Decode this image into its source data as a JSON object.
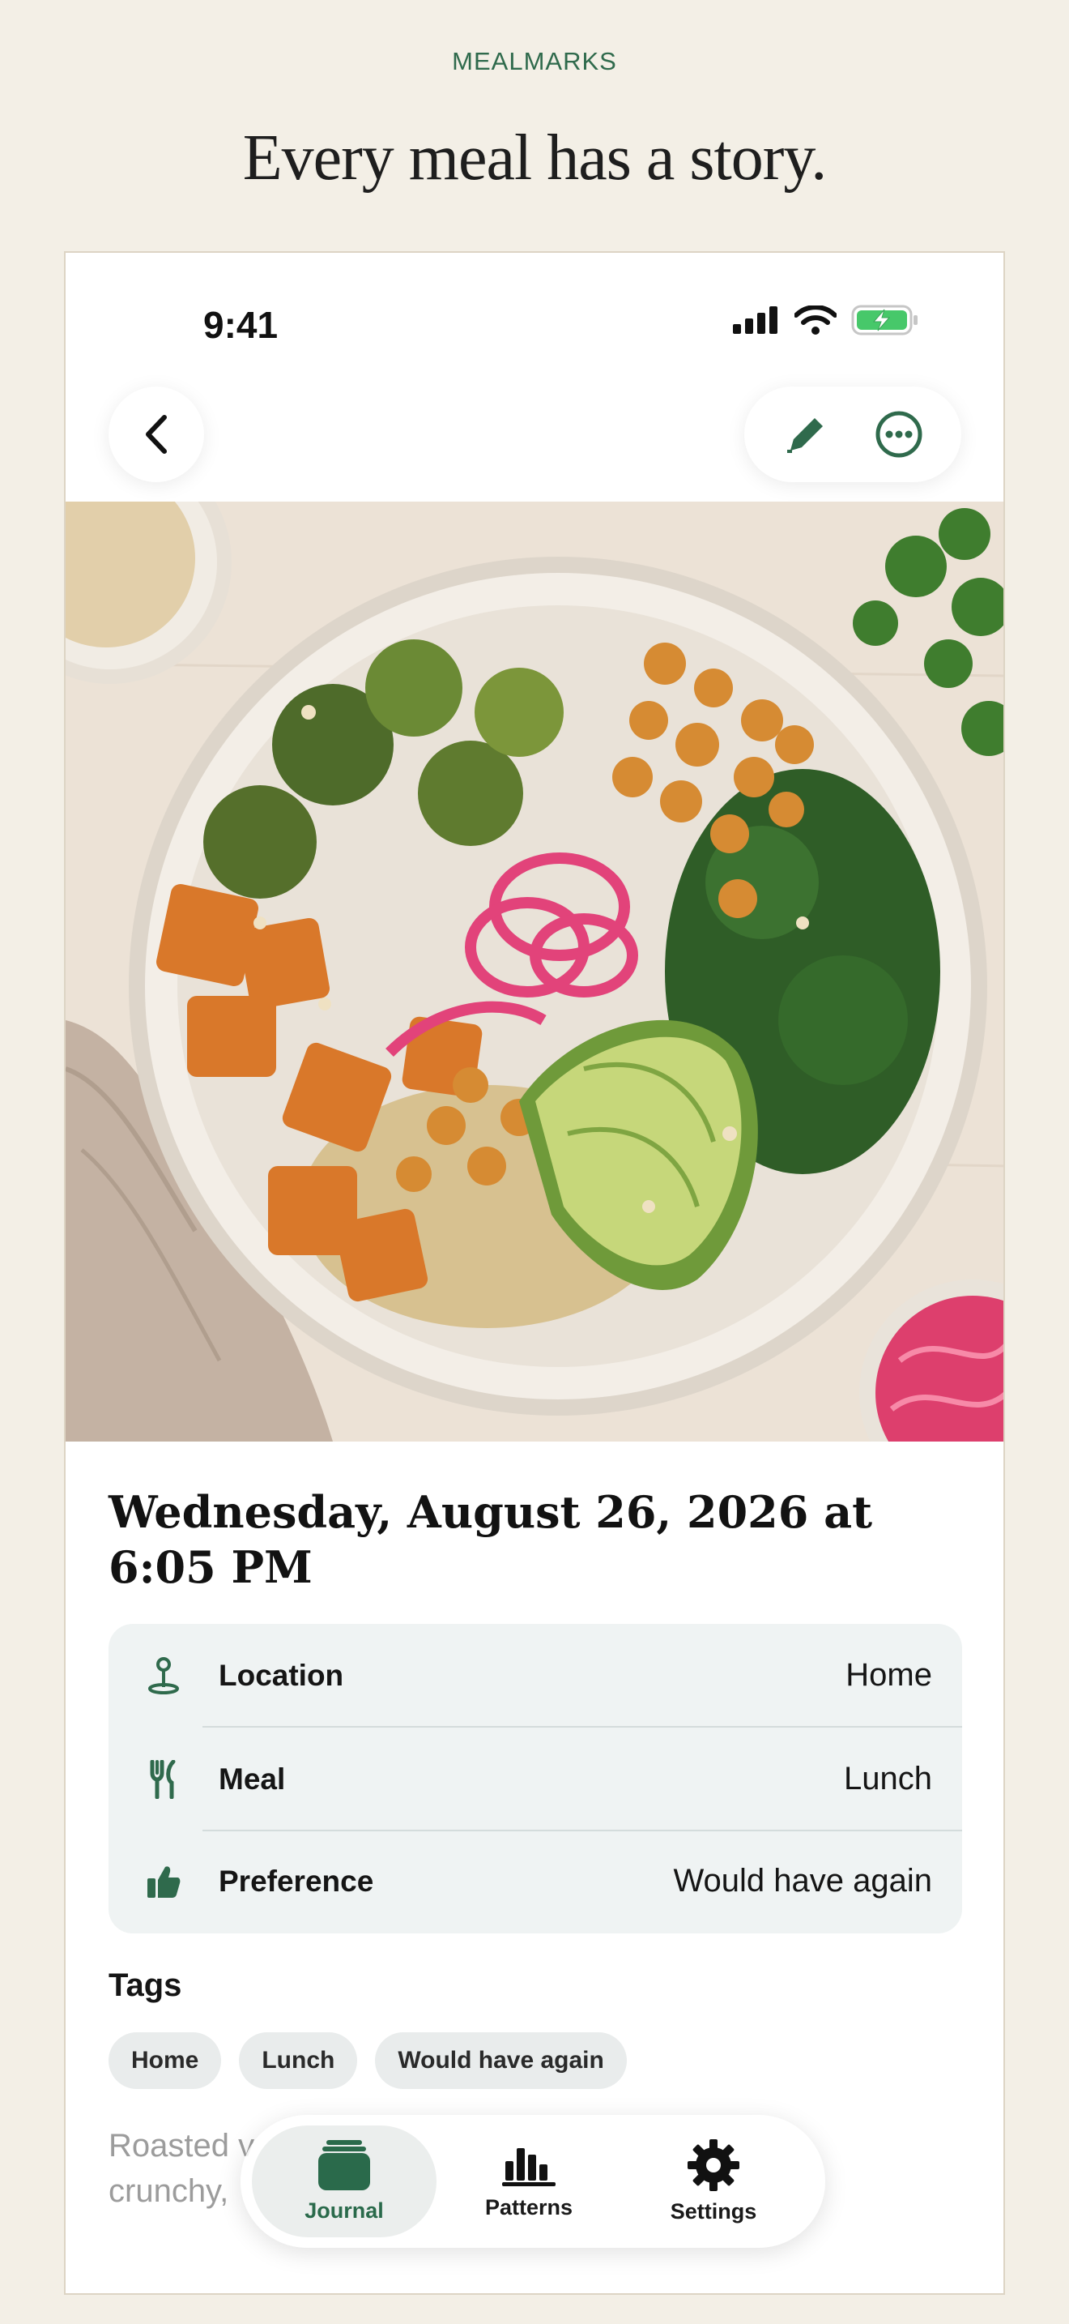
{
  "brand": "MEALMARKS",
  "headline": "Every meal has a story.",
  "status": {
    "time": "9:41"
  },
  "photo": {
    "subject": "grain-bowl"
  },
  "entry": {
    "date_line1": "Wednesday, August 26, 2026 at",
    "date_line2": "6:05 PM"
  },
  "details": [
    {
      "icon": "location-pin-icon",
      "label": "Location",
      "value": "Home"
    },
    {
      "icon": "fork-knife-icon",
      "label": "Meal",
      "value": "Lunch"
    },
    {
      "icon": "thumbs-up-icon",
      "label": "Preference",
      "value": "Would have again"
    }
  ],
  "tags": {
    "title": "Tags",
    "items": [
      "Home",
      "Lunch",
      "Would have again"
    ]
  },
  "notes": {
    "line1": "Roasted v",
    "line2": "crunchy,"
  },
  "tabbar": {
    "items": [
      {
        "label": "Journal",
        "icon": "journal-icon",
        "active": true
      },
      {
        "label": "Patterns",
        "icon": "bar-chart-icon",
        "active": false
      },
      {
        "label": "Settings",
        "icon": "gear-icon",
        "active": false
      }
    ]
  },
  "colors": {
    "background": "#f3efe6",
    "accent": "#2f6a4c",
    "card": "#eff3f3",
    "battery": "#47c86a"
  }
}
